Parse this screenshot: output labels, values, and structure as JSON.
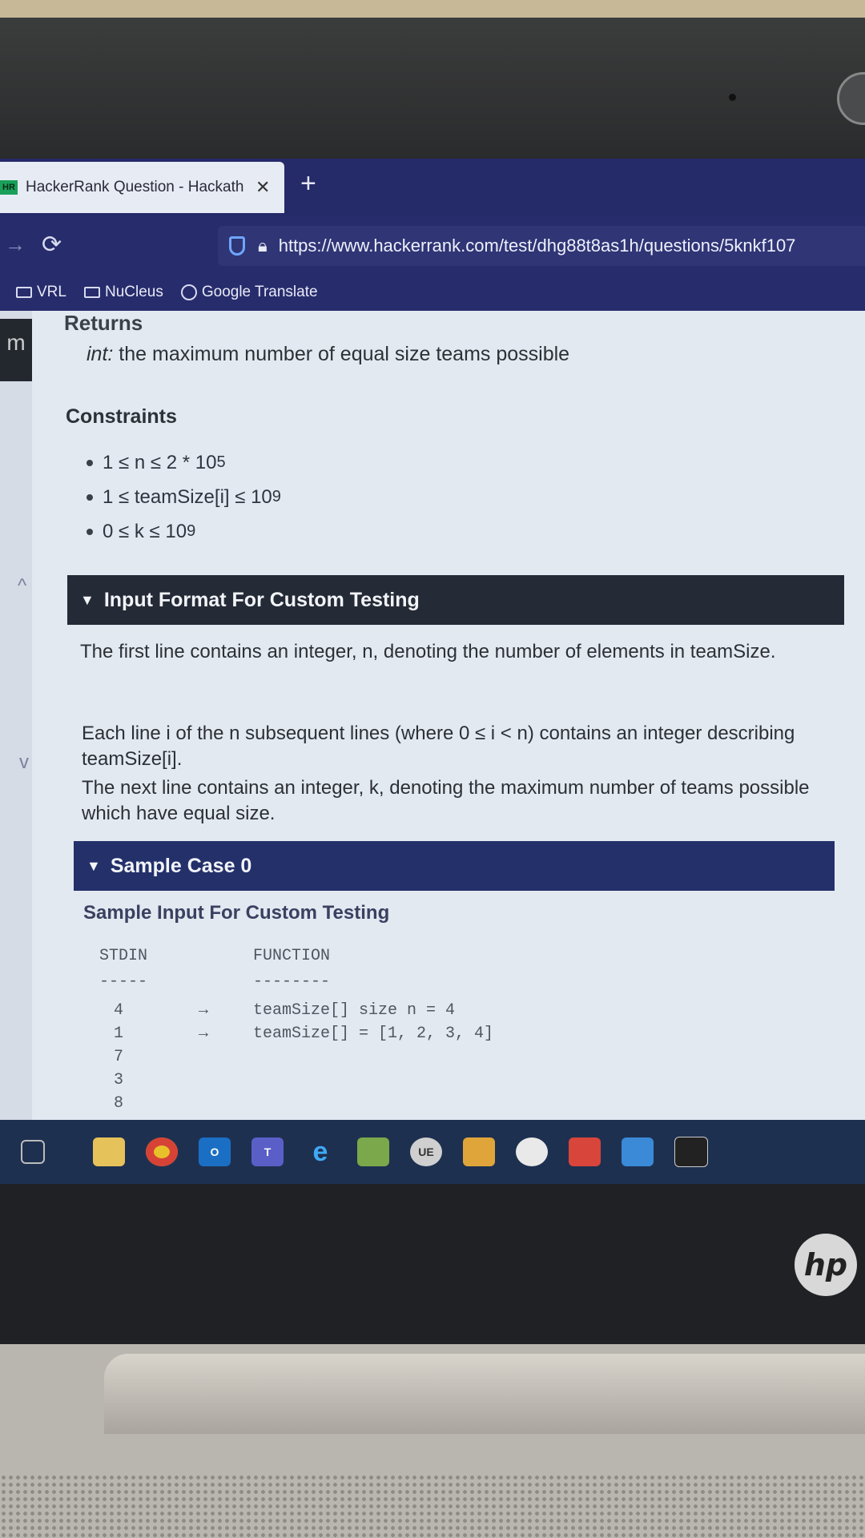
{
  "tab": {
    "favicon": "HR",
    "title": "HackerRank Question - Hackath",
    "close": "✕",
    "new_tab": "+"
  },
  "nav": {
    "reload_icon": "⟳",
    "url": "https://www.hackerrank.com/test/dhg88t8as1h/questions/5knkf107"
  },
  "bookmarks": [
    {
      "label": "VRL",
      "icon": "folder-icon"
    },
    {
      "label": "NuCleus",
      "icon": "folder-icon"
    },
    {
      "label": "Google Translate",
      "icon": "globe-icon"
    }
  ],
  "content": {
    "returns_heading": "Returns",
    "returns_type": "int:",
    "returns_desc": " the maximum number of equal size teams possible",
    "constraints_heading": "Constraints",
    "constraints": [
      {
        "text": "1 ≤ n ≤ 2 * 10",
        "sup": "5"
      },
      {
        "text": "1 ≤ teamSize[i] ≤ 10",
        "sup": "9"
      },
      {
        "text": "0 ≤ k ≤ 10",
        "sup": "9"
      }
    ],
    "input_format_heading": "Input Format For Custom Testing",
    "input_p1": "The first line contains an integer, n, denoting the number of elements in teamSize.",
    "input_p2": "Each line i of the n subsequent lines (where 0 ≤ i < n) contains an integer describing teamSize[i].",
    "input_p3": "The next line contains an integer, k, denoting the maximum number of teams possible which have equal size.",
    "sample_heading": "Sample Case 0",
    "sample_input_heading": "Sample Input For Custom Testing",
    "stdin_header": "STDIN",
    "function_header": "FUNCTION",
    "stdin_dash": "-----",
    "function_dash": "--------",
    "stdin_rows": [
      "4",
      "1",
      "7",
      "3",
      "8"
    ],
    "arrows": [
      "→",
      "→"
    ],
    "function_rows": [
      "teamSize[] size n = 4",
      "teamSize[] = [1, 2, 3, 4]"
    ]
  },
  "taskbar": {
    "icons": [
      "task-view-icon",
      "file-explorer-icon",
      "chrome-icon",
      "outlook-icon",
      "teams-icon",
      "edge-icon",
      "photo-icon",
      "ue-icon",
      "share-icon",
      "paint-icon",
      "app-icon",
      "network-app-icon",
      "terminal-icon"
    ]
  },
  "hp_logo": "hp"
}
